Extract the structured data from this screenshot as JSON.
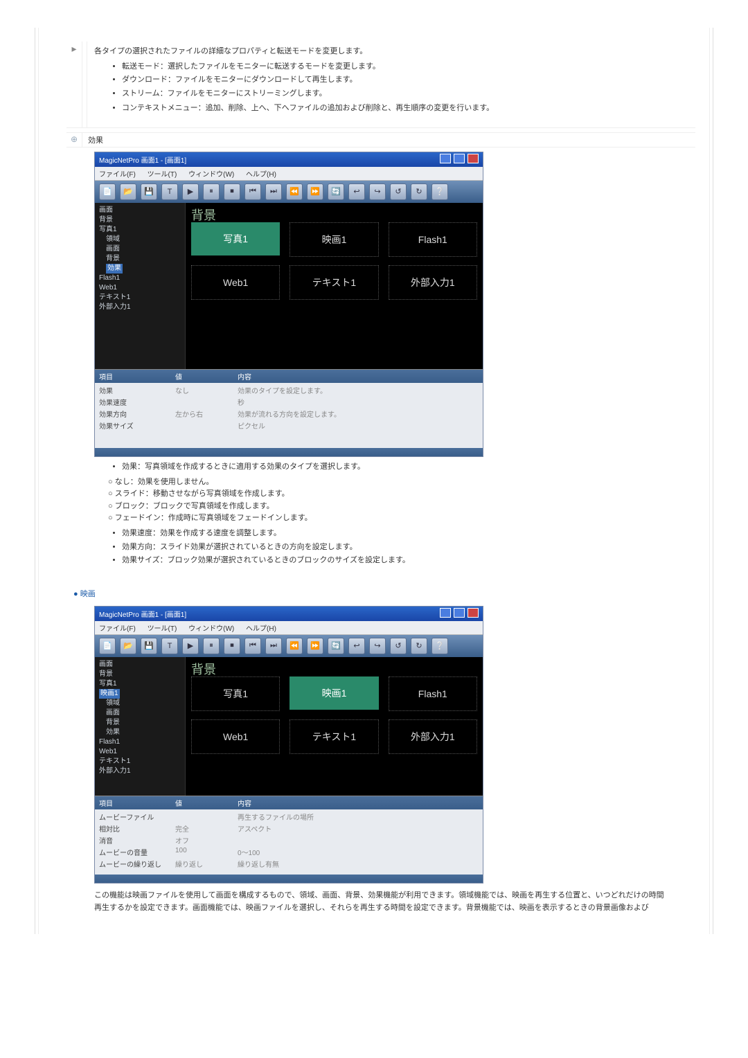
{
  "top": {
    "icon": "",
    "lead": "各タイプの選択されたファイルの詳細なプロパティと転送モードを変更します。",
    "bullets1": [
      "転送モード：選択したファイルをモニターに転送するモードを変更します。",
      "ダウンロード：ファイルをモニターにダウンロードして再生します。",
      "ストリーム：ファイルをモニターにストリーミングします。"
    ],
    "bullets2": [
      "コンテキストメニュー：追加、削除、上へ、下へファイルの追加および削除と、再生順序の変更を行います。"
    ]
  },
  "effect": {
    "heading": "効果",
    "screenshot1": {
      "title": "MagicNetPro 画面1 - [画面1]",
      "menu": [
        "ファイル(F)",
        "ツール(T)",
        "ウィンドウ(W)",
        "ヘルプ(H)"
      ],
      "toolbar_icons": [
        "📄",
        "📂",
        "💾",
        "T",
        "▶",
        "⏸",
        "⏹",
        "⏮",
        "⏭",
        "⏪",
        "⏩",
        "🔄",
        "↩",
        "↪",
        "↺",
        "↻",
        "❔"
      ],
      "tree_caption": "画面",
      "tree": [
        "背景",
        "写真1",
        "領域",
        "画面",
        "背景",
        "効果",
        "Flash1",
        "Web1",
        "テキスト1",
        "外部入力1"
      ],
      "selected": "効果",
      "bg": "背景",
      "slots_row1": [
        "写真1",
        "映画1",
        "Flash1"
      ],
      "slots_row2": [
        "Web1",
        "テキスト1",
        "外部入力1"
      ],
      "prop_header": [
        "項目",
        "値",
        "内容"
      ],
      "prop_rows": [
        [
          "効果",
          "なし",
          "効果のタイプを設定します。"
        ],
        [
          "効果速度",
          "",
          "秒"
        ],
        [
          "効果方向",
          "左から右",
          "効果が流れる方向を設定します。"
        ],
        [
          "効果サイズ",
          "",
          "ピクセル"
        ]
      ]
    },
    "bullets": [
      "効果：写真領域を作成するときに適用する効果のタイプを選択します。"
    ],
    "sub_bullets": [
      "なし：効果を使用しません。",
      "スライド：移動させながら写真領域を作成します。",
      "ブロック：ブロックで写真領域を作成します。",
      "フェードイン：作成時に写真領域をフェードインします。"
    ],
    "bullets2": [
      "効果速度：効果を作成する速度を調整します。",
      "効果方向：スライド効果が選択されているときの方向を設定します。",
      "効果サイズ：ブロック効果が選択されているときのブロックのサイズを設定します。"
    ]
  },
  "movie": {
    "heading": "映画",
    "screenshot2": {
      "title": "MagicNetPro 画面1 - [画面1]",
      "menu": [
        "ファイル(F)",
        "ツール(T)",
        "ウィンドウ(W)",
        "ヘルプ(H)"
      ],
      "toolbar_icons": [
        "📄",
        "📂",
        "💾",
        "T",
        "▶",
        "⏸",
        "⏹",
        "⏮",
        "⏭",
        "⏪",
        "⏩",
        "🔄",
        "↩",
        "↪",
        "↺",
        "↻",
        "❔"
      ],
      "tree_caption": "画面",
      "tree": [
        "背景",
        "写真1",
        "映画1",
        "領域",
        "画面",
        "背景",
        "効果",
        "Flash1",
        "Web1",
        "テキスト1",
        "外部入力1"
      ],
      "selected": "映画1",
      "bg": "背景",
      "slots_row1": [
        "写真1",
        "映画1",
        "Flash1"
      ],
      "slots_row2": [
        "Web1",
        "テキスト1",
        "外部入力1"
      ],
      "prop_header": [
        "項目",
        "値",
        "内容"
      ],
      "prop_rows": [
        [
          "ムービーファイル",
          "",
          "再生するファイルの場所"
        ],
        [
          "相対比",
          "完全",
          "アスペクト"
        ],
        [
          "消音",
          "オフ",
          ""
        ],
        [
          "ムービーの音量",
          "100",
          "0～100"
        ],
        [
          "ムービーの繰り返し",
          "繰り返し",
          "繰り返し有無"
        ]
      ]
    },
    "desc": "この機能は映画ファイルを使用して画面を構成するもので、領域、画面、背景、効果機能が利用できます。領域機能では、映画を再生する位置と、いつどれだけの時間再生するかを設定できます。画面機能では、映画ファイルを選択し、それらを再生する時間を設定できます。背景機能では、映画を表示するときの背景画像および"
  }
}
